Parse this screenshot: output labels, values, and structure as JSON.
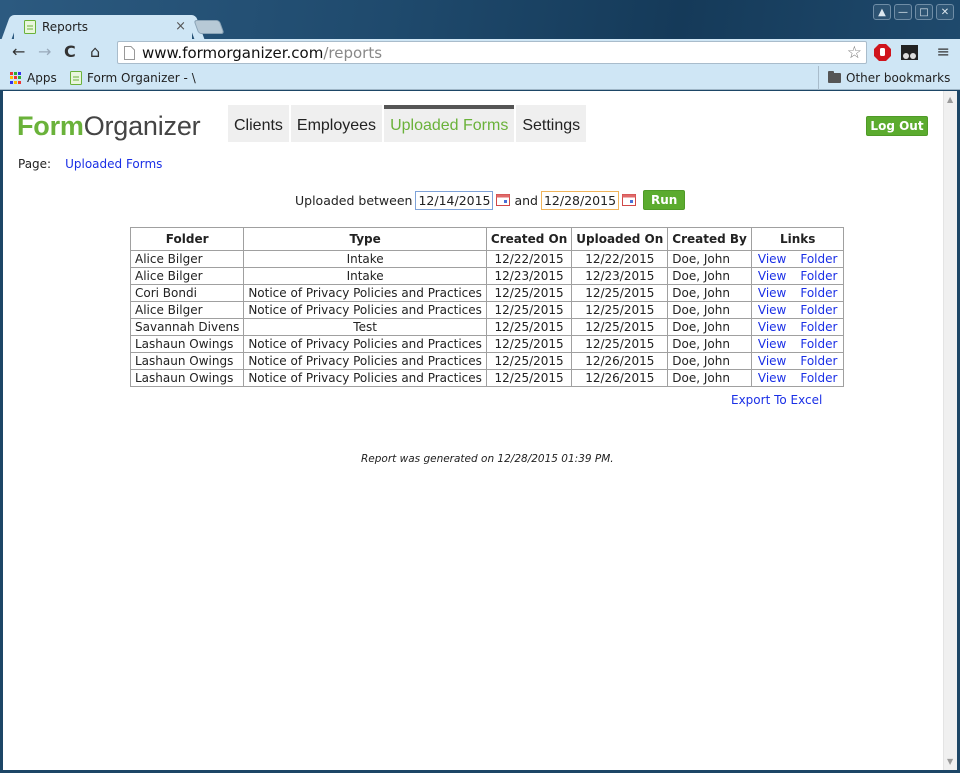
{
  "browser": {
    "tab_title": "Reports",
    "tab_close": "×",
    "url_domain": "www.formorganizer.com",
    "url_path": "/reports",
    "bookmarks": [
      {
        "label": "Apps",
        "icon": "apps-grid-icon"
      },
      {
        "label": "Form Organizer - \\",
        "icon": "document-icon"
      }
    ],
    "other_bookmarks": "Other bookmarks",
    "window_buttons": [
      "user-icon",
      "minimize-icon",
      "maximize-icon",
      "close-icon"
    ]
  },
  "app": {
    "logo_bold": "Form",
    "logo_rest": "Organizer",
    "nav": [
      {
        "label": "Clients",
        "active": false
      },
      {
        "label": "Employees",
        "active": false
      },
      {
        "label": "Uploaded Forms",
        "active": true
      },
      {
        "label": "Settings",
        "active": false
      }
    ],
    "logout_label": "Log Out",
    "breadcrumb": {
      "prefix": "Page:",
      "link": "Uploaded Forms"
    },
    "colors": {
      "brand_green": "#6ab23a",
      "button_green": "#5bab2e",
      "link_blue": "#1a2fe6"
    }
  },
  "filter": {
    "label": "Uploaded between",
    "start_date": "12/14/2015",
    "joiner": "and",
    "end_date": "12/28/2015",
    "run_label": "Run"
  },
  "table": {
    "headers": [
      "Folder",
      "Type",
      "Created On",
      "Uploaded On",
      "Created By",
      "Links"
    ],
    "rows": [
      {
        "folder": "Alice Bilger",
        "type": "Intake",
        "created_on": "12/22/2015",
        "uploaded_on": "12/22/2015",
        "created_by": "Doe, John",
        "view": "View",
        "folder_link": "Folder"
      },
      {
        "folder": "Alice Bilger",
        "type": "Intake",
        "created_on": "12/23/2015",
        "uploaded_on": "12/23/2015",
        "created_by": "Doe, John",
        "view": "View",
        "folder_link": "Folder"
      },
      {
        "folder": "Cori Bondi",
        "type": "Notice of Privacy Policies and Practices",
        "created_on": "12/25/2015",
        "uploaded_on": "12/25/2015",
        "created_by": "Doe, John",
        "view": "View",
        "folder_link": "Folder"
      },
      {
        "folder": "Alice Bilger",
        "type": "Notice of Privacy Policies and Practices",
        "created_on": "12/25/2015",
        "uploaded_on": "12/25/2015",
        "created_by": "Doe, John",
        "view": "View",
        "folder_link": "Folder"
      },
      {
        "folder": "Savannah Divens",
        "type": "Test",
        "created_on": "12/25/2015",
        "uploaded_on": "12/25/2015",
        "created_by": "Doe, John",
        "view": "View",
        "folder_link": "Folder"
      },
      {
        "folder": "Lashaun Owings",
        "type": "Notice of Privacy Policies and Practices",
        "created_on": "12/25/2015",
        "uploaded_on": "12/25/2015",
        "created_by": "Doe, John",
        "view": "View",
        "folder_link": "Folder"
      },
      {
        "folder": "Lashaun Owings",
        "type": "Notice of Privacy Policies and Practices",
        "created_on": "12/25/2015",
        "uploaded_on": "12/26/2015",
        "created_by": "Doe, John",
        "view": "View",
        "folder_link": "Folder"
      },
      {
        "folder": "Lashaun Owings",
        "type": "Notice of Privacy Policies and Practices",
        "created_on": "12/25/2015",
        "uploaded_on": "12/26/2015",
        "created_by": "Doe, John",
        "view": "View",
        "folder_link": "Folder"
      }
    ]
  },
  "export_label": "Export To Excel",
  "generated_text": "Report was generated on 12/28/2015 01:39 PM."
}
